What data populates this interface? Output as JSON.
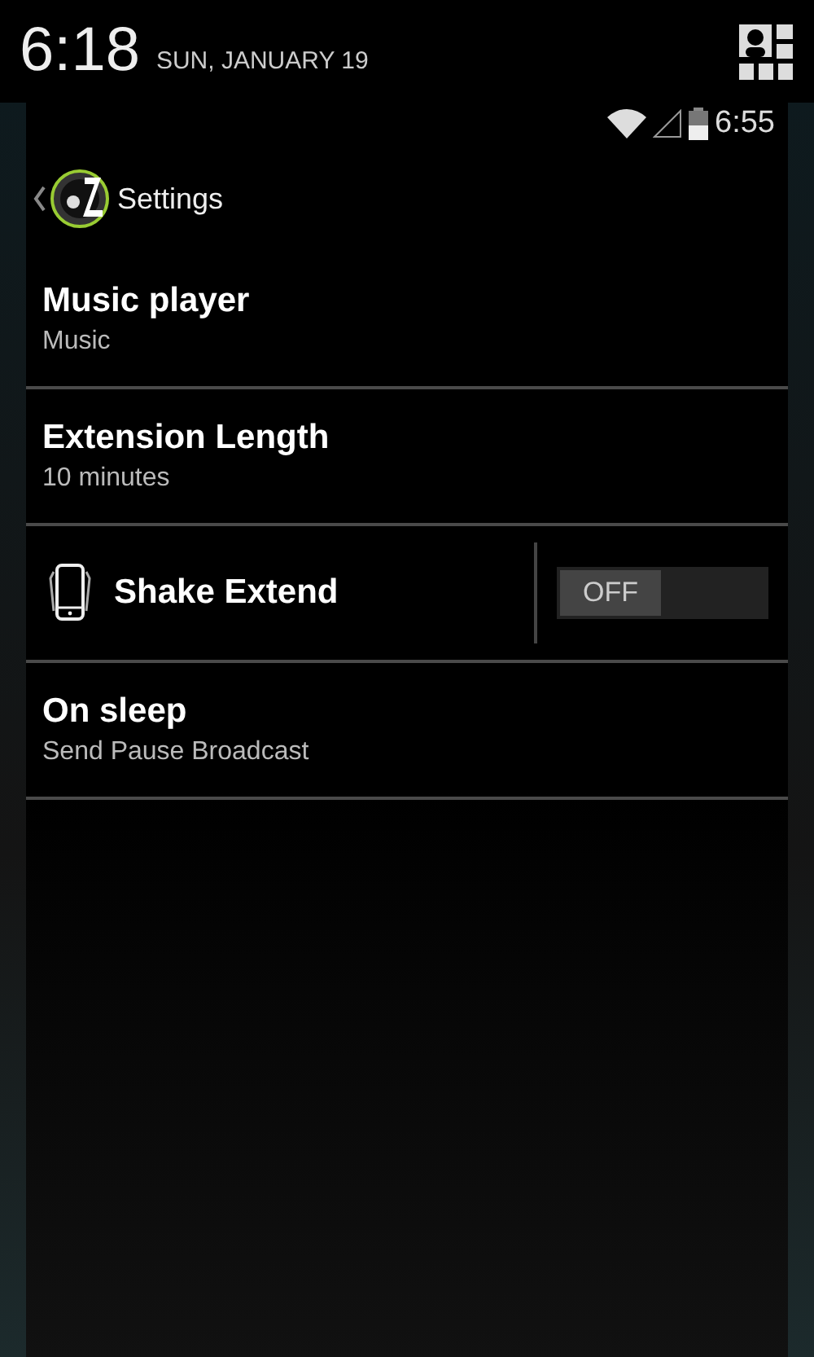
{
  "notification_header": {
    "time": "6:18",
    "date": "SUN, JANUARY 19"
  },
  "status_bar": {
    "time": "6:55"
  },
  "action_bar": {
    "title": "Settings"
  },
  "settings": [
    {
      "kind": "text",
      "title": "Music player",
      "summary": "Music"
    },
    {
      "kind": "text",
      "title": "Extension Length",
      "summary": "10 minutes"
    },
    {
      "kind": "toggle",
      "title": "Shake Extend",
      "on": false,
      "state_label": "OFF"
    },
    {
      "kind": "text",
      "title": "On sleep",
      "summary": "Send Pause Broadcast"
    }
  ]
}
